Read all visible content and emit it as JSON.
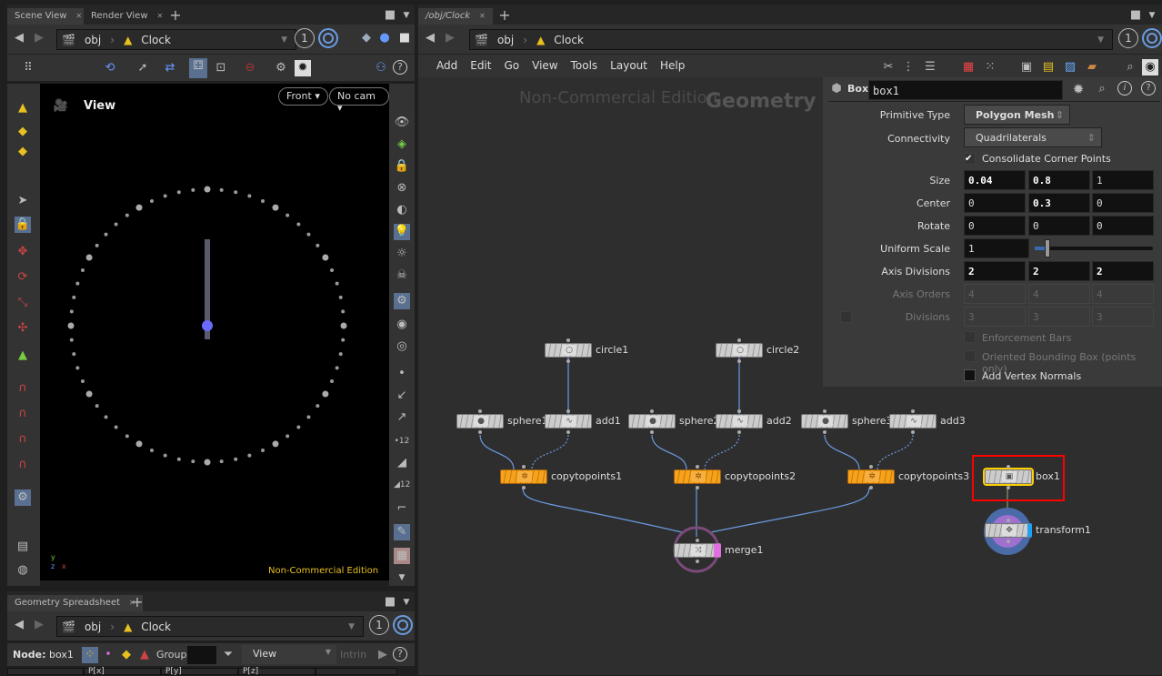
{
  "scene_pane": {
    "tabs": [
      {
        "label": "Scene View",
        "active": true
      },
      {
        "label": "Render View",
        "active": false
      }
    ],
    "path": {
      "root": "obj",
      "node": "Clock"
    },
    "viewport_count": "1",
    "view_label": "View",
    "camera_buttons": {
      "view": "Front",
      "camera": "No cam"
    },
    "watermark": "Non-Commercial Edition",
    "axis_labels": {
      "y": "y",
      "z": "z",
      "x": "x"
    },
    "clock": {
      "minute_marks": 60,
      "hour_marks": 12,
      "hand_color": "#5a5a6e",
      "pivot_color": "#6a6aff"
    }
  },
  "spreadsheet_pane": {
    "tabs": [
      {
        "label": "Geometry Spreadsheet",
        "active": true
      }
    ],
    "path": {
      "root": "obj",
      "node": "Clock"
    },
    "viewport_count": "1",
    "node_label": "Node:",
    "node_value": "box1",
    "group_label": "Group:",
    "view_select": "View",
    "intrinsic_label": "Intrin",
    "columns": [
      "",
      "P[x]",
      "P[y]",
      "P[z]",
      ""
    ]
  },
  "network_pane": {
    "tabs": [
      {
        "label": "/obj/Clock",
        "active": true
      }
    ],
    "path": {
      "root": "obj",
      "node": "Clock"
    },
    "viewport_count": "1",
    "menu": [
      "Add",
      "Edit",
      "Go",
      "View",
      "Tools",
      "Layout",
      "Help"
    ],
    "watermark": "Non-Commercial Edition",
    "context_label": "Geometry",
    "nodes": [
      {
        "name": "circle1",
        "icon": "circle-icon"
      },
      {
        "name": "circle2",
        "icon": "circle-icon"
      },
      {
        "name": "sphere1",
        "icon": "sphere-icon"
      },
      {
        "name": "add1",
        "icon": "wave-icon"
      },
      {
        "name": "sphere2",
        "icon": "sphere-icon"
      },
      {
        "name": "add2",
        "icon": "wave-icon"
      },
      {
        "name": "sphere3",
        "icon": "sphere-icon"
      },
      {
        "name": "add3",
        "icon": "wave-icon"
      },
      {
        "name": "copytopoints1",
        "icon": "copy-icon"
      },
      {
        "name": "copytopoints2",
        "icon": "copy-icon"
      },
      {
        "name": "copytopoints3",
        "icon": "copy-icon"
      },
      {
        "name": "box1",
        "icon": "box-icon",
        "selected": true
      },
      {
        "name": "transform1",
        "icon": "transform-icon",
        "display": true
      },
      {
        "name": "merge1",
        "icon": "merge-icon"
      }
    ],
    "colors": {
      "copytopoints": "#f7a21b",
      "wire": "#6a9be0",
      "highlight": "#ff0000",
      "selected": "#ffd000"
    }
  },
  "parameters": {
    "node_type": "Box",
    "node_name": "box1",
    "primitive_type": {
      "label": "Primitive Type",
      "value": "Polygon Mesh"
    },
    "connectivity": {
      "label": "Connectivity",
      "value": "Quadrilaterals"
    },
    "consolidate": {
      "label": "Consolidate Corner Points",
      "checked": true
    },
    "size": {
      "label": "Size",
      "values": [
        "0.04",
        "0.8",
        "1"
      ]
    },
    "center": {
      "label": "Center",
      "values": [
        "0",
        "0.3",
        "0"
      ]
    },
    "rotate": {
      "label": "Rotate",
      "values": [
        "0",
        "0",
        "0"
      ]
    },
    "uniform_scale": {
      "label": "Uniform Scale",
      "value": "1"
    },
    "axis_divisions": {
      "label": "Axis Divisions",
      "values": [
        "2",
        "2",
        "2"
      ]
    },
    "axis_orders": {
      "label": "Axis Orders",
      "values": [
        "4",
        "4",
        "4"
      ]
    },
    "divisions": {
      "label": "Divisions",
      "values": [
        "3",
        "3",
        "3"
      ]
    },
    "enforcement_bars": {
      "label": "Enforcement Bars",
      "checked": false
    },
    "oriented_bbox": {
      "label": "Oriented Bounding Box (points only)",
      "checked": false
    },
    "vertex_normals": {
      "label": "Add Vertex Normals",
      "checked": false
    }
  }
}
